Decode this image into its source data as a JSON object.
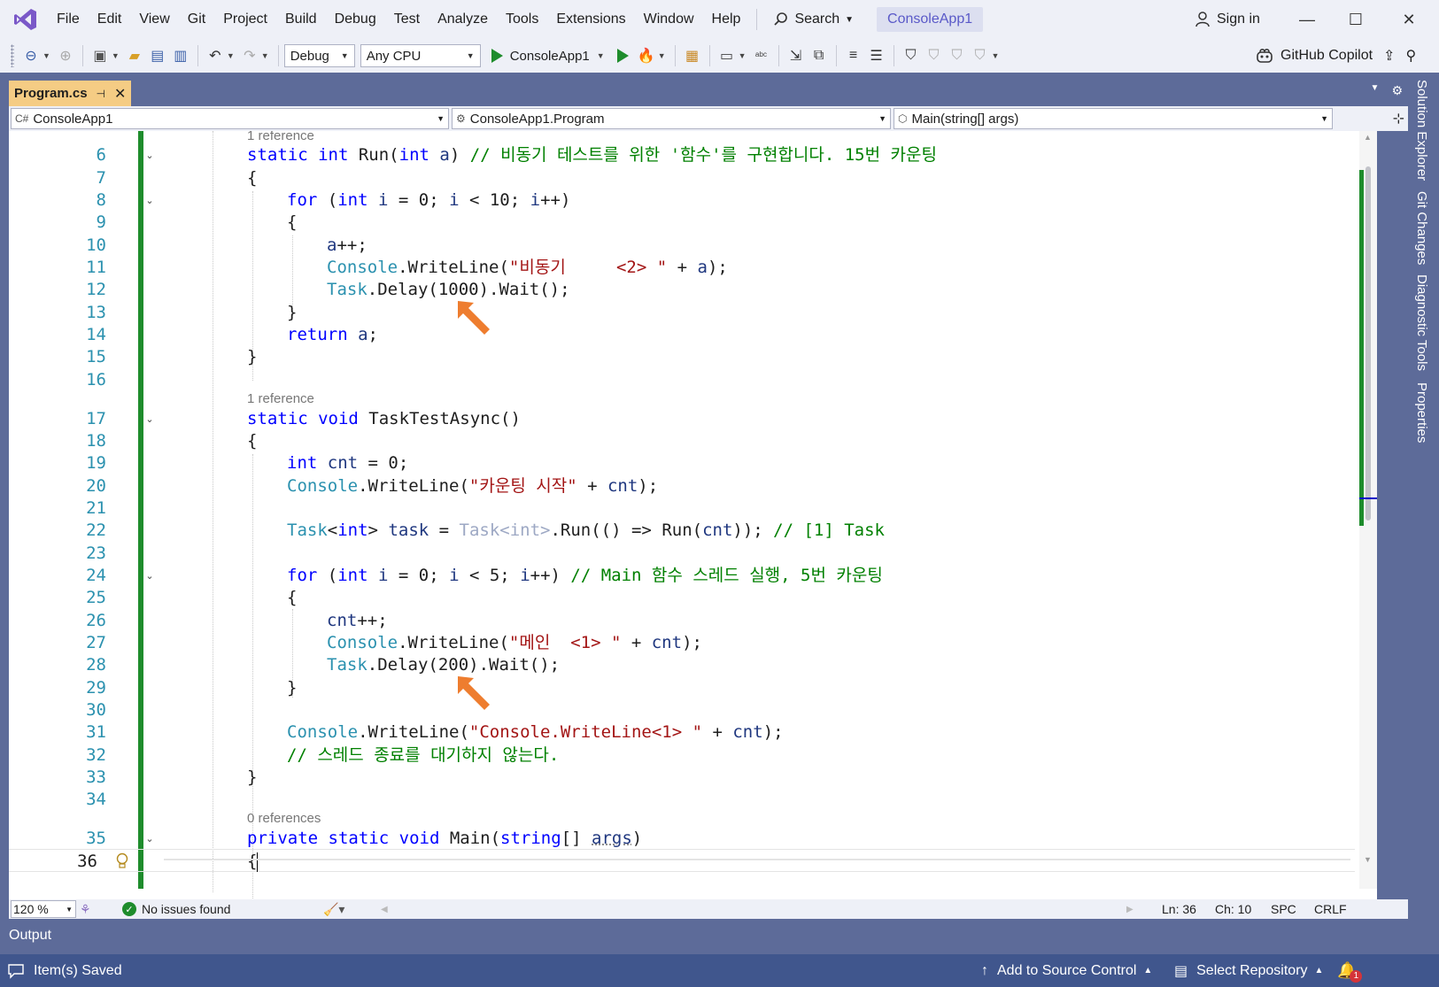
{
  "menubar": {
    "items": [
      "File",
      "Edit",
      "View",
      "Git",
      "Project",
      "Build",
      "Debug",
      "Test",
      "Analyze",
      "Tools",
      "Extensions",
      "Window",
      "Help"
    ],
    "search_label": "Search",
    "solution_name": "ConsoleApp1",
    "sign_in": "Sign in"
  },
  "toolbar": {
    "configuration": "Debug",
    "platform": "Any CPU",
    "run_target": "ConsoleApp1",
    "copilot": "GitHub Copilot"
  },
  "tab": {
    "filename": "Program.cs"
  },
  "navbar": {
    "project": "ConsoleApp1",
    "type": "ConsoleApp1.Program",
    "member": "Main(string[] args)"
  },
  "editor": {
    "codelens": [
      "1 reference",
      "1 reference",
      "0 references"
    ],
    "line_numbers": [
      "6",
      "7",
      "8",
      "9",
      "10",
      "11",
      "12",
      "13",
      "14",
      "15",
      "16",
      "17",
      "18",
      "19",
      "20",
      "21",
      "22",
      "23",
      "24",
      "25",
      "26",
      "27",
      "28",
      "29",
      "30",
      "31",
      "32",
      "33",
      "34",
      "35",
      "36"
    ],
    "lines": {
      "l6_comment": "// 비동기 테스트를 위한 '함수'를 구현합니다. 15번 카운팅",
      "l11_str": "\"비동기     <2> \"",
      "l12_num": "1000",
      "l20_str": "\"카운팅 시작\"",
      "l22_comment": "// [1] Task",
      "l24_comment": "// Main 함수 스레드 실행, 5번 카운팅",
      "l27_str": "\"메인  <1> \"",
      "l28_num": "200",
      "l31_str": "\"Console.WriteLine<1> \"",
      "l32_comment": "// 스레드 종료를 대기하지 않는다."
    }
  },
  "editor_status": {
    "zoom": "120 %",
    "issues": "No issues found",
    "line": "Ln: 36",
    "col": "Ch: 10",
    "whitespace": "SPC",
    "line_ending": "CRLF"
  },
  "output": {
    "title": "Output"
  },
  "statusbar": {
    "message": "Item(s) Saved",
    "source_control": "Add to Source Control",
    "repository": "Select Repository",
    "notification_count": "1"
  },
  "rail": {
    "tabs": [
      "Solution Explorer",
      "Git Changes",
      "Diagnostic Tools",
      "Properties"
    ]
  },
  "colors": {
    "keyword": "#0000ff",
    "type": "#2b91af",
    "string": "#a31515",
    "comment": "#008000",
    "accent_tab": "#f5cc84",
    "change_margin": "#1e8c2c",
    "arrow_annotation": "#ee7d2f"
  }
}
